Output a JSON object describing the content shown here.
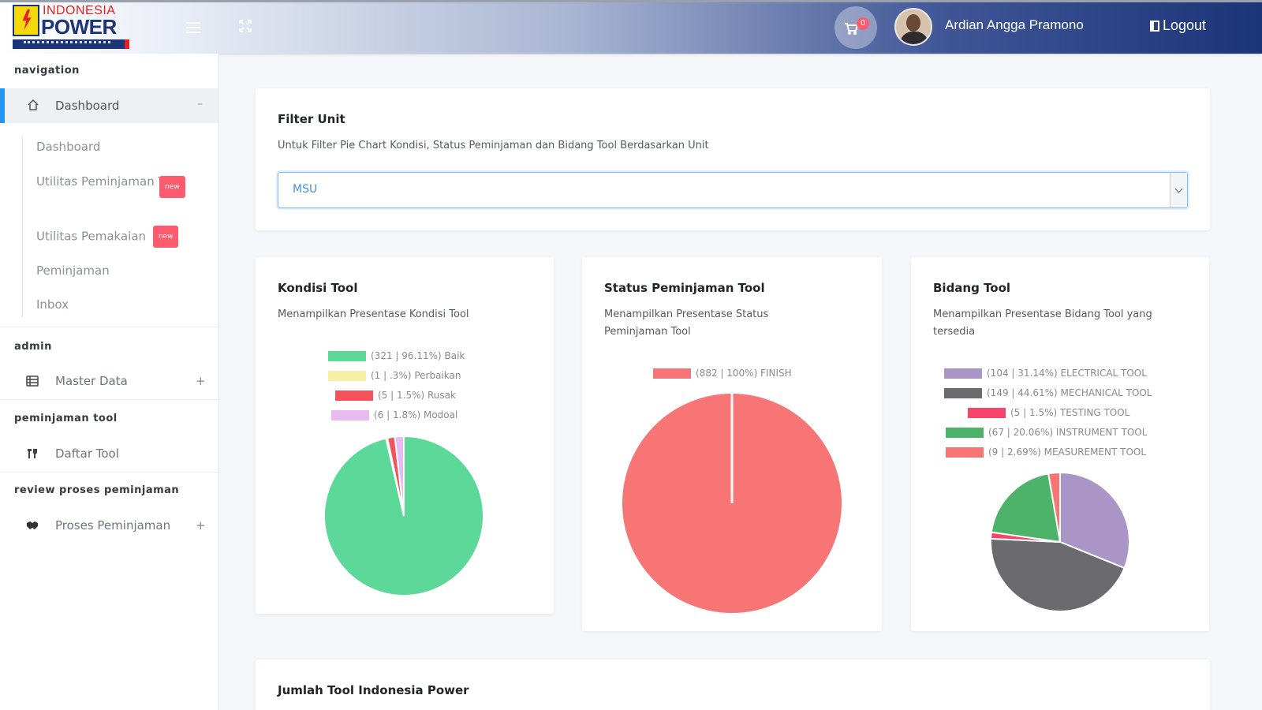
{
  "header": {
    "logo": {
      "line1": "INDONESIA",
      "line2": "POWER"
    },
    "cart_count": "0",
    "user_name": "Ardian Angga Pramono",
    "logout_label": "Logout"
  },
  "sidebar": {
    "sections": {
      "navigation": "navigation",
      "admin": "admin",
      "peminjaman": "peminjaman tool",
      "review": "review proses peminjaman"
    },
    "dashboard_label": "Dashboard",
    "dashboard_toggle": "–",
    "sub_items": {
      "dashboard": "Dashboard",
      "utilitas_peminjaman": "Utilitas Peminjaman Tool",
      "utilitas_pemakaian": "Utilitas Pemakaian",
      "peminjaman": "Peminjaman",
      "inbox": "Inbox"
    },
    "new_badge": "new",
    "master_data": "Master Data",
    "daftar_tool": "Daftar Tool",
    "proses_peminjaman": "Proses Peminjaman",
    "plus": "+"
  },
  "filter": {
    "title": "Filter Unit",
    "subtitle": "Untuk Filter Pie Chart Kondisi, Status Peminjaman dan Bidang Tool Berdasarkan Unit",
    "selected": "MSU"
  },
  "bottom_card": {
    "title": "Jumlah Tool Indonesia Power"
  },
  "chart_data": [
    {
      "type": "pie",
      "title": "Kondisi Tool",
      "subtitle": "Menampilkan Presentase Kondisi Tool",
      "legend": [
        "(321 | 96.11%) Baik",
        "(1 | .3%) Perbaikan",
        "(5 | 1.5%) Rusak",
        "(6 | 1.8%) Modoal"
      ],
      "values": [
        321,
        1,
        5,
        6
      ],
      "colors": [
        "#5cd898",
        "#f5f0a6",
        "#f5525b",
        "#e9b9f2"
      ]
    },
    {
      "type": "pie",
      "title": "Status Peminjaman Tool",
      "subtitle": "Menampilkan Presentase Status Peminjaman Tool",
      "legend": [
        "(882 | 100%) FINISH"
      ],
      "values": [
        882
      ],
      "colors": [
        "#f87575"
      ]
    },
    {
      "type": "pie",
      "title": "Bidang Tool",
      "subtitle": "Menampilkan Presentase Bidang Tool yang tersedia",
      "legend": [
        "(104 | 31.14%) ELECTRICAL TOOL",
        "(149 | 44.61%) MECHANICAL TOOL",
        "(5 | 1.5%) TESTING TOOL",
        "(67 | 20.06%) INSTRUMENT TOOL",
        "(9 | 2.69%) MEASUREMENT TOOL"
      ],
      "values": [
        104,
        149,
        5,
        67,
        9
      ],
      "colors": [
        "#ab94c6",
        "#6b6a6e",
        "#f5456a",
        "#4eb36a",
        "#f87575"
      ]
    }
  ]
}
